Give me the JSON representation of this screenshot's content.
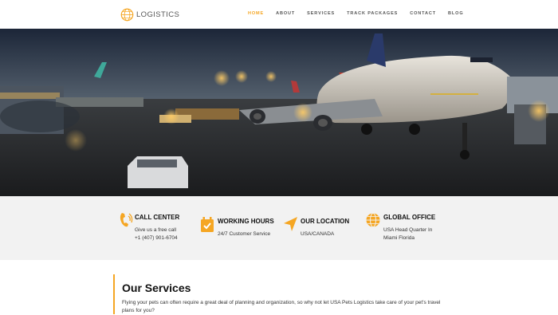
{
  "header": {
    "logo_text": "LOGISTICS",
    "nav": [
      {
        "label": "HOME",
        "active": true
      },
      {
        "label": "ABOUT"
      },
      {
        "label": "SERVICES"
      },
      {
        "label": "TRACK PACKAGES"
      },
      {
        "label": "CONTACT"
      },
      {
        "label": "BLOG"
      }
    ]
  },
  "hero": {
    "image_icon": "airport-airplane-image"
  },
  "info": [
    {
      "icon": "phone-icon",
      "title": "CALL CENTER",
      "lines": [
        "Give us a free call",
        "+1 (407) 901-6704"
      ]
    },
    {
      "icon": "calendar-check-icon",
      "title": "WORKING HOURS",
      "lines": [
        "24/7 Customer Service"
      ]
    },
    {
      "icon": "location-arrow-icon",
      "title": "OUR LOCATION",
      "lines": [
        "USA/CANADA"
      ]
    },
    {
      "icon": "globe-icon",
      "title": "GLOBAL OFFICE",
      "lines": [
        "USA Head Quarter In",
        "Miami Florida"
      ]
    }
  ],
  "services": {
    "title": "Our Services",
    "description": "Flying your pets can often require a great deal of planning and organization, so why not let USA Pets Logistics take care of your pet's travel plans for you?"
  },
  "colors": {
    "accent": "#f5a623",
    "info_bg": "#f2f2f2"
  }
}
